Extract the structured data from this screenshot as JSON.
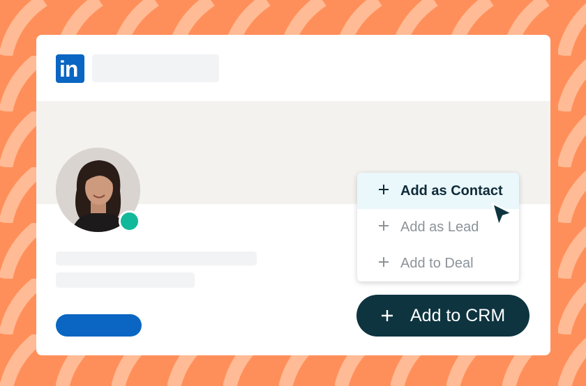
{
  "theme": {
    "background": "#ff8f5a",
    "pattern": "#ffbb95",
    "linkedin_blue": "#0a66c2",
    "status_green": "#12b89a",
    "crm_button": "#0e3440",
    "menu_highlight": "#eaf7fb"
  },
  "header": {
    "logo_text": "in",
    "logo_icon": "linkedin-logo-icon"
  },
  "profile": {
    "avatar_icon": "avatar-photo",
    "status": "online"
  },
  "crm_menu": {
    "items": [
      {
        "label": "Add as Contact",
        "icon": "plus-icon",
        "active": true
      },
      {
        "label": "Add as Lead",
        "icon": "plus-icon",
        "active": false
      },
      {
        "label": "Add to Deal",
        "icon": "plus-icon",
        "active": false
      }
    ]
  },
  "crm_button": {
    "label": "Add to CRM",
    "icon": "plus-icon"
  }
}
